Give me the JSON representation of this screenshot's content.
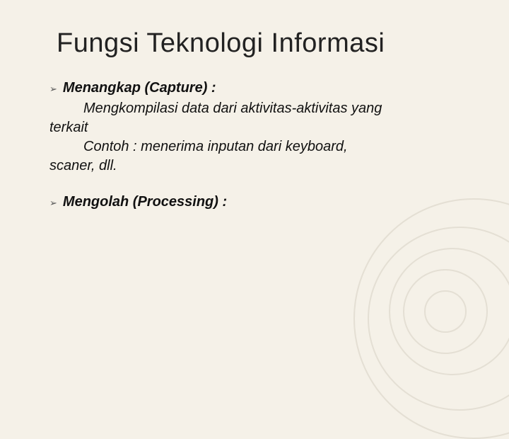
{
  "title": "Fungsi Teknologi Informasi",
  "items": [
    {
      "heading": "Menangkap (Capture) :",
      "line1": "Mengkompilasi data dari aktivitas-aktivitas yang",
      "line1wrap": "terkait",
      "line2": "Contoh : menerima inputan dari keyboard,",
      "line2wrap": "scaner, dll."
    },
    {
      "heading": "Mengolah (Processing) :"
    }
  ]
}
